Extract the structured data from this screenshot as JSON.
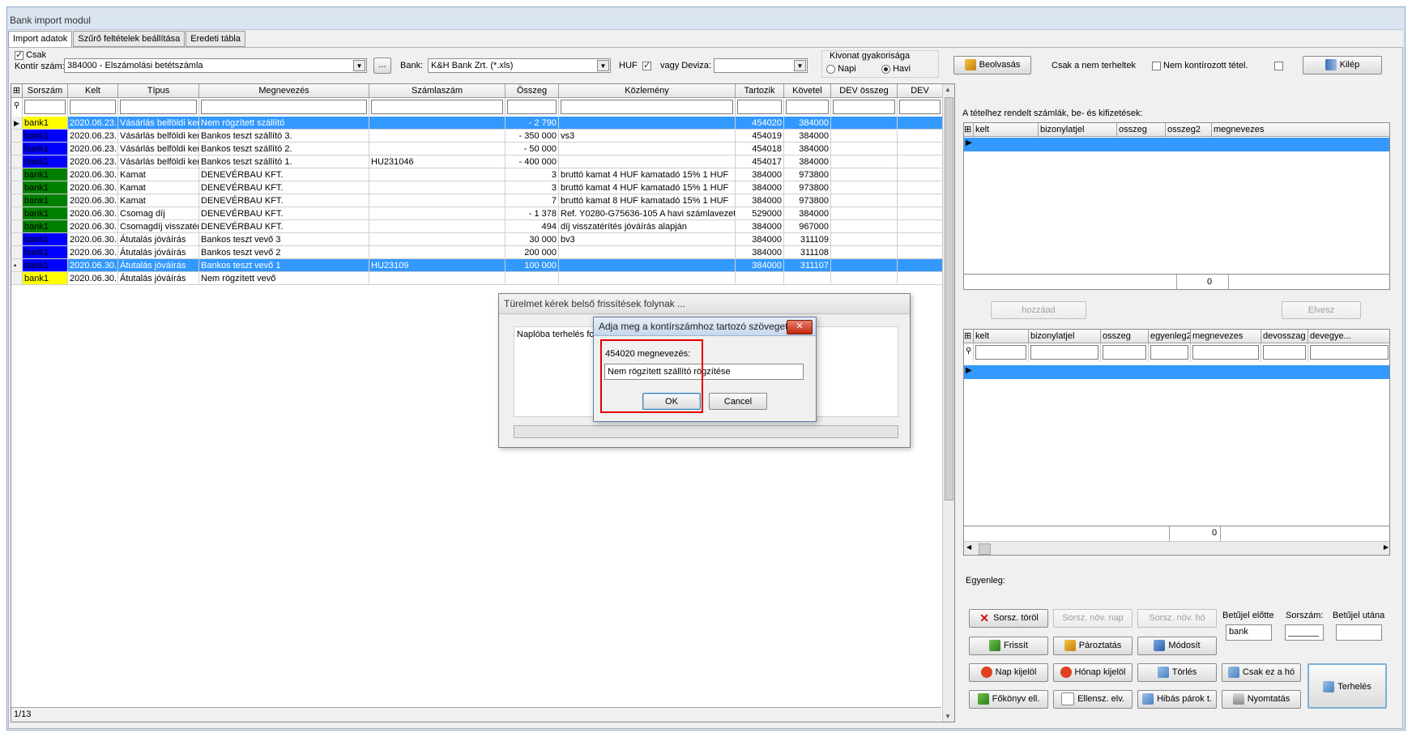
{
  "window": {
    "title": "Bank import modul"
  },
  "tabs": [
    "Import adatok",
    "Szűrő feltételek beállítása",
    "Eredeti tábla"
  ],
  "toolbar": {
    "csak_label": "Csak",
    "kontir_label": "Kontír szám:",
    "kontir_value": "384000 - Elszámolási betétszámla",
    "ellipsis": "...",
    "bank_label": "Bank:",
    "bank_value": "K&H Bank Zrt. (*.xls)",
    "huf_label": "HUF",
    "deviza_label": "vagy Deviza:",
    "deviza_value": "",
    "freq_title": "Kivonat gyakorisága",
    "freq_napi": "Napi",
    "freq_havi": "Havi",
    "beolvasas": "Beolvasás",
    "csak_nem_terheltek": "Csak a nem terheltek",
    "nem_kontirozott": "Nem kontírozott tétel.",
    "kilep": "Kilép"
  },
  "main_grid": {
    "headers": [
      "Sorszám",
      "Kelt",
      "Típus",
      "Megnevezés",
      "Számlaszám",
      "Összeg",
      "Közlemény",
      "Tartozik",
      "Követel",
      "DEV összeg",
      "DEV"
    ],
    "rows": [
      {
        "marker": "▶",
        "sorszam": "bank1",
        "color": "#ffff00",
        "kelt": "2020.06.23.",
        "tipus": "Vásárlás belföldi kere",
        "megnev": "Nem rögzített szállító",
        "szamla": "",
        "osszeg": "- 2 790",
        "kozl": "",
        "tart": "454020",
        "kov": "384000",
        "sel": true
      },
      {
        "marker": "",
        "sorszam": "bank1",
        "color": "#0000ff",
        "kelt": "2020.06.23.",
        "tipus": "Vásárlás belföldi kere",
        "megnev": "Bankos teszt szállító 3.",
        "szamla": "",
        "osszeg": "- 350 000",
        "kozl": "vs3",
        "tart": "454019",
        "kov": "384000",
        "sel": false
      },
      {
        "marker": "",
        "sorszam": "bank1",
        "color": "#0000ff",
        "kelt": "2020.06.23.",
        "tipus": "Vásárlás belföldi kere",
        "megnev": "Bankos teszt szállító 2.",
        "szamla": "",
        "osszeg": "- 50 000",
        "kozl": "",
        "tart": "454018",
        "kov": "384000",
        "sel": false
      },
      {
        "marker": "",
        "sorszam": "bank1",
        "color": "#0000ff",
        "kelt": "2020.06.23.",
        "tipus": "Vásárlás belföldi kere",
        "megnev": "Bankos teszt szállító 1.",
        "szamla": "HU231046",
        "osszeg": "- 400 000",
        "kozl": "",
        "tart": "454017",
        "kov": "384000",
        "sel": false
      },
      {
        "marker": "",
        "sorszam": "bank1",
        "color": "#008000",
        "kelt": "2020.06.30.",
        "tipus": "Kamat",
        "megnev": "DENEVÉRBAU KFT.",
        "szamla": "",
        "osszeg": "3",
        "kozl": "bruttó kamat 4 HUF kamatadó 15% 1 HUF",
        "tart": "384000",
        "kov": "973800",
        "sel": false
      },
      {
        "marker": "",
        "sorszam": "bank1",
        "color": "#008000",
        "kelt": "2020.06.30.",
        "tipus": "Kamat",
        "megnev": "DENEVÉRBAU KFT.",
        "szamla": "",
        "osszeg": "3",
        "kozl": "bruttó kamat 4 HUF kamatadó 15% 1 HUF",
        "tart": "384000",
        "kov": "973800",
        "sel": false
      },
      {
        "marker": "",
        "sorszam": "bank1",
        "color": "#008000",
        "kelt": "2020.06.30.",
        "tipus": "Kamat",
        "megnev": "DENEVÉRBAU KFT.",
        "szamla": "",
        "osszeg": "7",
        "kozl": "bruttó kamat 8 HUF kamatadó 15% 1 HUF",
        "tart": "384000",
        "kov": "973800",
        "sel": false
      },
      {
        "marker": "",
        "sorszam": "bank1",
        "color": "#008000",
        "kelt": "2020.06.30.",
        "tipus": "Csomag díj",
        "megnev": "DENEVÉRBAU KFT.",
        "szamla": "",
        "osszeg": "- 1 378",
        "kozl": "Ref. Y0280-G75636-105 A havi számlavezeté",
        "tart": "529000",
        "kov": "384000",
        "sel": false
      },
      {
        "marker": "",
        "sorszam": "bank1",
        "color": "#008000",
        "kelt": "2020.06.30.",
        "tipus": "Csomagdíj visszatéri",
        "megnev": "DENEVÉRBAU KFT.",
        "szamla": "",
        "osszeg": "494",
        "kozl": "díj visszatérítés jóváírás alapján",
        "tart": "384000",
        "kov": "967000",
        "sel": false
      },
      {
        "marker": "",
        "sorszam": "bank1",
        "color": "#0000ff",
        "kelt": "2020.06.30.",
        "tipus": "Átutalás jóváírás",
        "megnev": "Bankos teszt vevő 3",
        "szamla": "",
        "osszeg": "30 000",
        "kozl": "bv3",
        "tart": "384000",
        "kov": "311109",
        "sel": false
      },
      {
        "marker": "",
        "sorszam": "bank1",
        "color": "#0000ff",
        "kelt": "2020.06.30.",
        "tipus": "Átutalás jóváírás",
        "megnev": "Bankos teszt vevő 2",
        "szamla": "",
        "osszeg": "200 000",
        "kozl": "",
        "tart": "384000",
        "kov": "311108",
        "sel": false
      },
      {
        "marker": "•",
        "sorszam": "bank1",
        "color": "#0000ff",
        "kelt": "2020.06.30.",
        "tipus": "Átutalás jóváírás",
        "megnev": "Bankos teszt vevő 1",
        "szamla": "HU23109",
        "osszeg": "100 000",
        "kozl": "",
        "tart": "384000",
        "kov": "311107",
        "sel": true
      },
      {
        "marker": "",
        "sorszam": "bank1",
        "color": "#ffff00",
        "kelt": "2020.06.30.",
        "tipus": "Átutalás jóváírás",
        "megnev": "Nem rögzített vevő",
        "szamla": "",
        "osszeg": "",
        "kozl": "",
        "tart": "",
        "kov": "",
        "sel": false
      }
    ],
    "status": "1/13"
  },
  "right_top": {
    "label": "A tételhez rendelt számlák, be- és kifizetések:",
    "headers": [
      "kelt",
      "bizonylatjel",
      "osszeg",
      "osszeg2",
      "megnevezes"
    ],
    "total": "0",
    "hozzaad": "hozzáad",
    "elvesz": "Elvesz"
  },
  "right_bottom": {
    "headers": [
      "kelt",
      "bizonylatjel",
      "osszeg",
      "egyenleg2",
      "megnevezes",
      "devosszag",
      "devegye..."
    ],
    "total": "0",
    "egyenleg": "Egyenleg:"
  },
  "buttons": {
    "sorsz_torol": "Sorsz. töröl",
    "sorsz_nov_nap": "Sorsz. növ. nap",
    "sorsz_nov_ho": "Sorsz. növ. hó",
    "betujel_elotte_label": "Betűjel előtte",
    "betujel_elotte_value": "bank",
    "sorszam_label": "Sorszám:",
    "betujel_utana_label": "Betűjel utána",
    "frissit": "Frissít",
    "paroztatas": "Pároztatás",
    "modosit": "Módosít",
    "nap_kijelol": "Nap kijelöl",
    "honap_kijelol": "Hónap kijelöl",
    "torles": "Törlés",
    "csak_ez_a_ho": "Csak ez a hó",
    "terheles": "Terhelés",
    "fokonyv": "Főkönyv ell.",
    "ellensz": "Ellensz. elv.",
    "hibas_parok": "Hibás párok t.",
    "nyomtatas": "Nyomtatás"
  },
  "progress_dialog": {
    "title": "Türelmet kérek belső frissítések folynak ...",
    "text": "Naplóba terhelés fol"
  },
  "prompt_dialog": {
    "title": "Adja meg a kontírszámhoz tartozó szöveget",
    "label": "454020 megnevezés:",
    "value": "Nem rögzített szállító rögzítése",
    "ok": "OK",
    "cancel": "Cancel"
  }
}
